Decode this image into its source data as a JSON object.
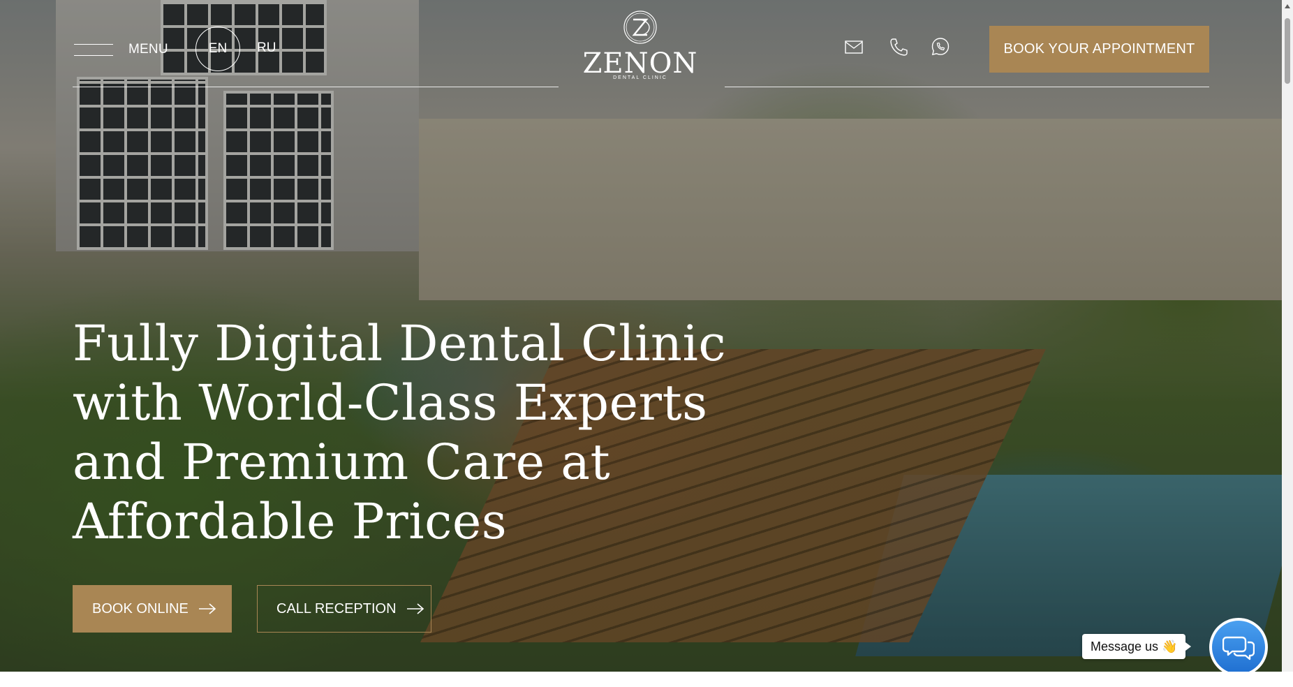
{
  "header": {
    "menu_label": "MENU",
    "languages": [
      "EN",
      "RU"
    ],
    "active_language": "EN",
    "logo": {
      "name": "ZENON",
      "subtitle": "DENTAL CLINIC",
      "mark": "ZD monogram"
    },
    "icons": [
      "mail-icon",
      "phone-icon",
      "whatsapp-icon"
    ],
    "book_appointment_label": "BOOK YOUR APPOINTMENT"
  },
  "hero": {
    "headline": "Fully Digital Dental Clinic with World-Class Experts and Premium Care at Affordable Prices",
    "book_online_label": "BOOK ONLINE",
    "call_reception_label": "CALL RECEPTION"
  },
  "chat": {
    "bubble_text": "Message us 👋",
    "icon": "chat-bubbles-icon"
  },
  "colors": {
    "accent": "#a98654",
    "text_on_image": "#ffffff",
    "chat_button": "#2b82e0"
  }
}
